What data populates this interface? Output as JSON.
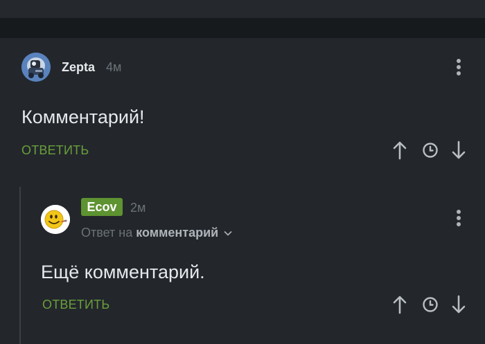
{
  "comments": [
    {
      "author": "Zepta",
      "time": "4м",
      "text": "Комментарий!",
      "reply_label": "ОТВЕТИТЬ"
    },
    {
      "author": "Ecov",
      "time": "2м",
      "reply_to_prefix": "Ответ на",
      "reply_to_target": "комментарий",
      "text": "Ещё комментарий.",
      "reply_label": "ОТВЕТИТЬ"
    }
  ],
  "icons": {
    "more": "more-vertical-icon",
    "upvote": "arrow-up-icon",
    "save": "clock-icon",
    "downvote": "arrow-down-icon",
    "expand": "chevron-down-icon"
  },
  "colors": {
    "background": "#23272c",
    "accent_green": "#6a9f3a",
    "badge_green": "#5e9331",
    "text": "#e6e8ea",
    "muted": "#6b7278"
  }
}
